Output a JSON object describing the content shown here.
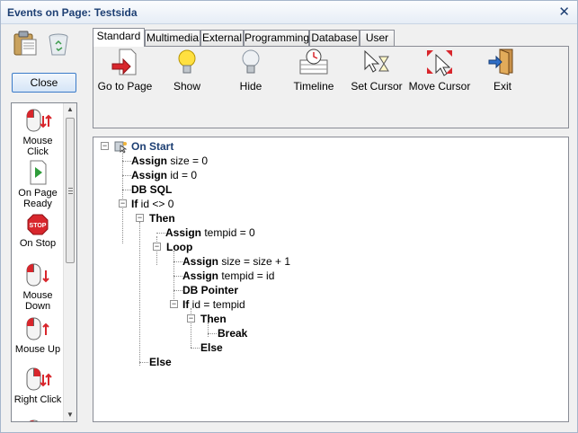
{
  "window": {
    "title": "Events on Page: Testsida",
    "close_glyph": "✕"
  },
  "left": {
    "close_label": "Close",
    "events": [
      {
        "icon": "mouse-click-icon",
        "label": "Mouse Click"
      },
      {
        "icon": "on-page-ready-icon",
        "label": "On Page Ready"
      },
      {
        "icon": "stop-icon",
        "label": "On Stop"
      },
      {
        "icon": "mouse-down-icon",
        "label": "Mouse Down"
      },
      {
        "icon": "mouse-up-icon",
        "label": "Mouse Up"
      },
      {
        "icon": "right-click-icon",
        "label": "Right Click"
      }
    ]
  },
  "tabs": [
    "Standard",
    "Multimedia",
    "External",
    "Programming",
    "Database",
    "User"
  ],
  "active_tab": "Standard",
  "tools": [
    {
      "icon": "go-to-page-icon",
      "label": "Go to Page"
    },
    {
      "icon": "lightbulb-on-icon",
      "label": "Show"
    },
    {
      "icon": "lightbulb-off-icon",
      "label": "Hide"
    },
    {
      "icon": "timeline-icon",
      "label": "Timeline"
    },
    {
      "icon": "set-cursor-icon",
      "label": "Set Cursor"
    },
    {
      "icon": "move-cursor-icon",
      "label": "Move Cursor"
    },
    {
      "icon": "exit-icon",
      "label": "Exit"
    }
  ],
  "tree": [
    {
      "kw": "On Start",
      "rest": ""
    },
    {
      "kw": "Assign",
      "rest": " size = 0"
    },
    {
      "kw": "Assign",
      "rest": " id = 0"
    },
    {
      "kw": "DB SQL",
      "rest": ""
    },
    {
      "kw": "If",
      "rest": " id <> 0"
    },
    {
      "kw": "Then",
      "rest": ""
    },
    {
      "kw": "Assign",
      "rest": " tempid = 0"
    },
    {
      "kw": "Loop",
      "rest": ""
    },
    {
      "kw": "Assign",
      "rest": " size = size + 1"
    },
    {
      "kw": "Assign",
      "rest": " tempid = id"
    },
    {
      "kw": "DB Pointer",
      "rest": ""
    },
    {
      "kw": "If",
      "rest": " id = tempid"
    },
    {
      "kw": "Then",
      "rest": ""
    },
    {
      "kw": "Break",
      "rest": ""
    },
    {
      "kw": "Else",
      "rest": ""
    },
    {
      "kw": "Else",
      "rest": ""
    }
  ],
  "toggle_glyph": "−"
}
